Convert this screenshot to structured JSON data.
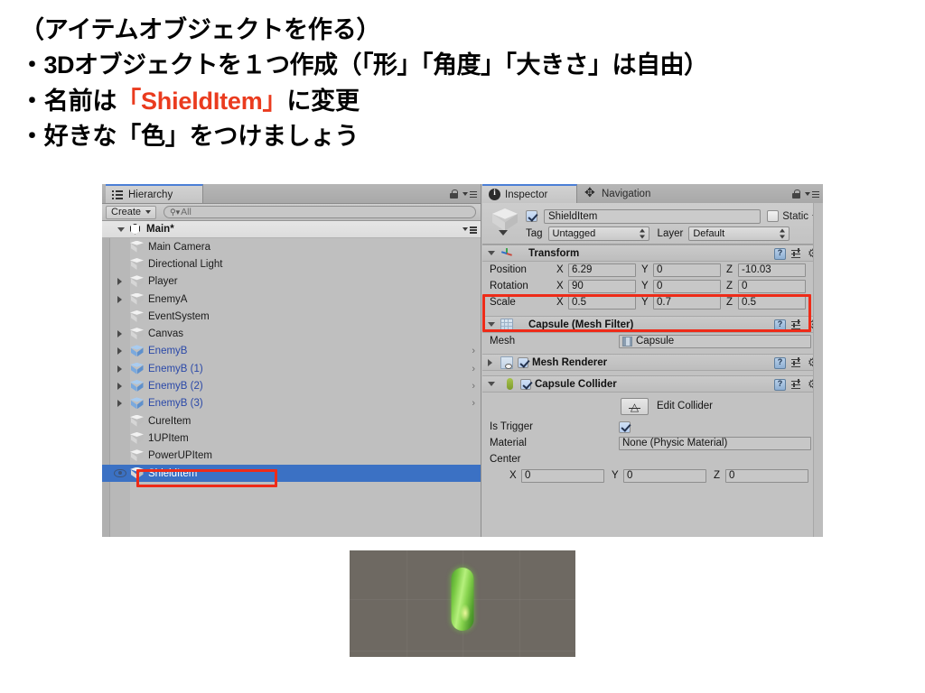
{
  "slide": {
    "lines": [
      {
        "text": "（アイテムオブジェクトを作る）",
        "highlight": null
      },
      {
        "text": "・3Dオブジェクトを１つ作成（「形」「角度」「大きさ」は自由）",
        "highlight": null
      },
      {
        "pre": "・名前は",
        "highlight": "「ShieldItem」",
        "post": "に変更"
      },
      {
        "text": "・好きな「色」をつけましょう",
        "highlight": null
      }
    ],
    "line1": "（アイテムオブジェクトを作る）",
    "line2": "・3Dオブジェクトを１つ作成（「形」「角度」「大きさ」は自由）",
    "line3_pre": "・名前は",
    "line3_hl": "「ShieldItem」",
    "line3_post": "に変更",
    "line4": "・好きな「色」をつけましょう",
    "accent_color": "#ea3b1e"
  },
  "hierarchy": {
    "tab_label": "Hierarchy",
    "create_button": "Create",
    "search_placeholder": "All",
    "search_value": "",
    "scene_name": "Main*",
    "items": [
      {
        "label": "Main Camera",
        "foldout": false,
        "prefab": false,
        "chevron": false,
        "selected": false
      },
      {
        "label": "Directional Light",
        "foldout": false,
        "prefab": false,
        "chevron": false,
        "selected": false
      },
      {
        "label": "Player",
        "foldout": true,
        "prefab": false,
        "chevron": false,
        "selected": false
      },
      {
        "label": "EnemyA",
        "foldout": true,
        "prefab": false,
        "chevron": false,
        "selected": false
      },
      {
        "label": "EventSystem",
        "foldout": false,
        "prefab": false,
        "chevron": false,
        "selected": false
      },
      {
        "label": "Canvas",
        "foldout": true,
        "prefab": false,
        "chevron": false,
        "selected": false
      },
      {
        "label": "EnemyB",
        "foldout": true,
        "prefab": true,
        "chevron": true,
        "selected": false
      },
      {
        "label": "EnemyB (1)",
        "foldout": true,
        "prefab": true,
        "chevron": true,
        "selected": false
      },
      {
        "label": "EnemyB (2)",
        "foldout": true,
        "prefab": true,
        "chevron": true,
        "selected": false
      },
      {
        "label": "EnemyB (3)",
        "foldout": true,
        "prefab": true,
        "chevron": true,
        "selected": false
      },
      {
        "label": "CureItem",
        "foldout": false,
        "prefab": false,
        "chevron": false,
        "selected": false
      },
      {
        "label": "1UPItem",
        "foldout": false,
        "prefab": false,
        "chevron": false,
        "selected": false
      },
      {
        "label": "PowerUPItem",
        "foldout": false,
        "prefab": false,
        "chevron": false,
        "selected": false
      },
      {
        "label": "ShieldItem",
        "foldout": false,
        "prefab": false,
        "chevron": false,
        "selected": true
      }
    ],
    "selection_color": "#3b71c4",
    "prefab_label_color": "#2a48a8"
  },
  "inspector": {
    "tabs": [
      {
        "label": "Inspector",
        "active": true
      },
      {
        "label": "Navigation",
        "active": false
      }
    ],
    "object": {
      "enabled": true,
      "name": "ShieldItem",
      "static_label": "Static",
      "static_checked": false,
      "tag_label": "Tag",
      "tag_value": "Untagged",
      "layer_label": "Layer",
      "layer_value": "Default"
    },
    "transform": {
      "title": "Transform",
      "rows": [
        {
          "label": "Position",
          "x": "6.29",
          "y": "0",
          "z": "-10.03"
        },
        {
          "label": "Rotation",
          "x": "90",
          "y": "0",
          "z": "0"
        },
        {
          "label": "Scale",
          "x": "0.5",
          "y": "0.7",
          "z": "0.5"
        }
      ],
      "axis_x": "X",
      "axis_y": "Y",
      "axis_z": "Z"
    },
    "mesh_filter": {
      "title": "Capsule (Mesh Filter)",
      "mesh_label": "Mesh",
      "mesh_value": "Capsule"
    },
    "mesh_renderer": {
      "title": "Mesh Renderer",
      "enabled": true
    },
    "capsule_collider": {
      "title": "Capsule Collider",
      "enabled": true,
      "edit_collider_label": "Edit Collider",
      "is_trigger_label": "Is Trigger",
      "is_trigger_checked": true,
      "material_label": "Material",
      "material_value": "None (Physic Material)",
      "center_label": "Center",
      "center_x": "0",
      "center_y": "0",
      "center_z": "0",
      "axis_x": "X",
      "axis_y": "Y",
      "axis_z": "Z"
    }
  },
  "annotations": {
    "color": "#ee2b18",
    "boxes": [
      "hierarchy-shielditem",
      "transform-rotation-scale"
    ]
  },
  "preview": {
    "background_color": "#6e6962",
    "capsule_color": "#79c943"
  }
}
